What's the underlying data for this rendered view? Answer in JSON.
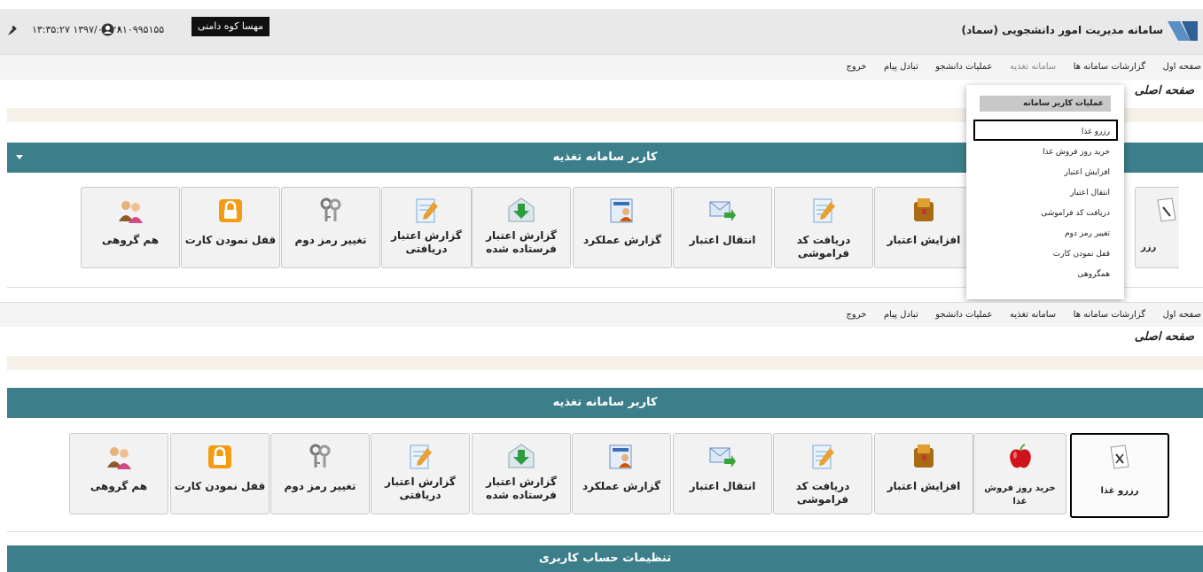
{
  "header": {
    "app_title": "سامانه مدیریت امور دانشجویی (سماد)",
    "datetime": "۱۳:۳۵:۲۷ ۱۳۹۷/۰۴/۲۶",
    "user_id": "۸۱۰۹۹۵۱۵۵",
    "user_name": "مهسا کوه دامنی"
  },
  "nav": {
    "items": [
      "صفحه اول",
      "گزارشات سامانه ها",
      "سامانه تغذیه",
      "عملیات دانشجو",
      "تبادل پیام",
      "خروج"
    ],
    "active_index_top": 2
  },
  "page_heading": "صفحه اصلی",
  "section_food": "کاربر سامانه تغذیه",
  "section_account": "تنظیمات حساب کاربری",
  "dropdown": {
    "title": "عملیات کاربر سامانه",
    "items": [
      "رزرو غذا",
      "خرید روز فروش غذا",
      "افزایش اعتبار",
      "انتقال اعتبار",
      "دریافت کد فراموشی",
      "تغییر رمز دوم",
      "قفل نمودن کارت",
      "همگروهی"
    ],
    "selected_index": 0
  },
  "tiles": [
    {
      "label": "رزرو غذا",
      "icon": "reserve-food-icon"
    },
    {
      "label": "خرید روز فروش غذا",
      "icon": "apple-icon"
    },
    {
      "label": "افزایش اعتبار",
      "icon": "wallet-icon"
    },
    {
      "label": "دریافت کد فراموشی",
      "icon": "notepad-icon"
    },
    {
      "label": "انتقال اعتبار",
      "icon": "mail-forward-icon"
    },
    {
      "label": "گزارش عملکرد",
      "icon": "user-report-icon"
    },
    {
      "label": "گزارش اعتبار فرستاده شده",
      "icon": "envelope-download-icon"
    },
    {
      "label": "گزارش اعتبار دریافتی",
      "icon": "notepad-icon"
    },
    {
      "label": "تغییر رمز دوم",
      "icon": "keys-icon"
    },
    {
      "label": "قفل نمودن کارت",
      "icon": "lock-icon"
    },
    {
      "label": "هم گروهی",
      "icon": "group-icon"
    }
  ],
  "top_row_partial_label": "رزر"
}
